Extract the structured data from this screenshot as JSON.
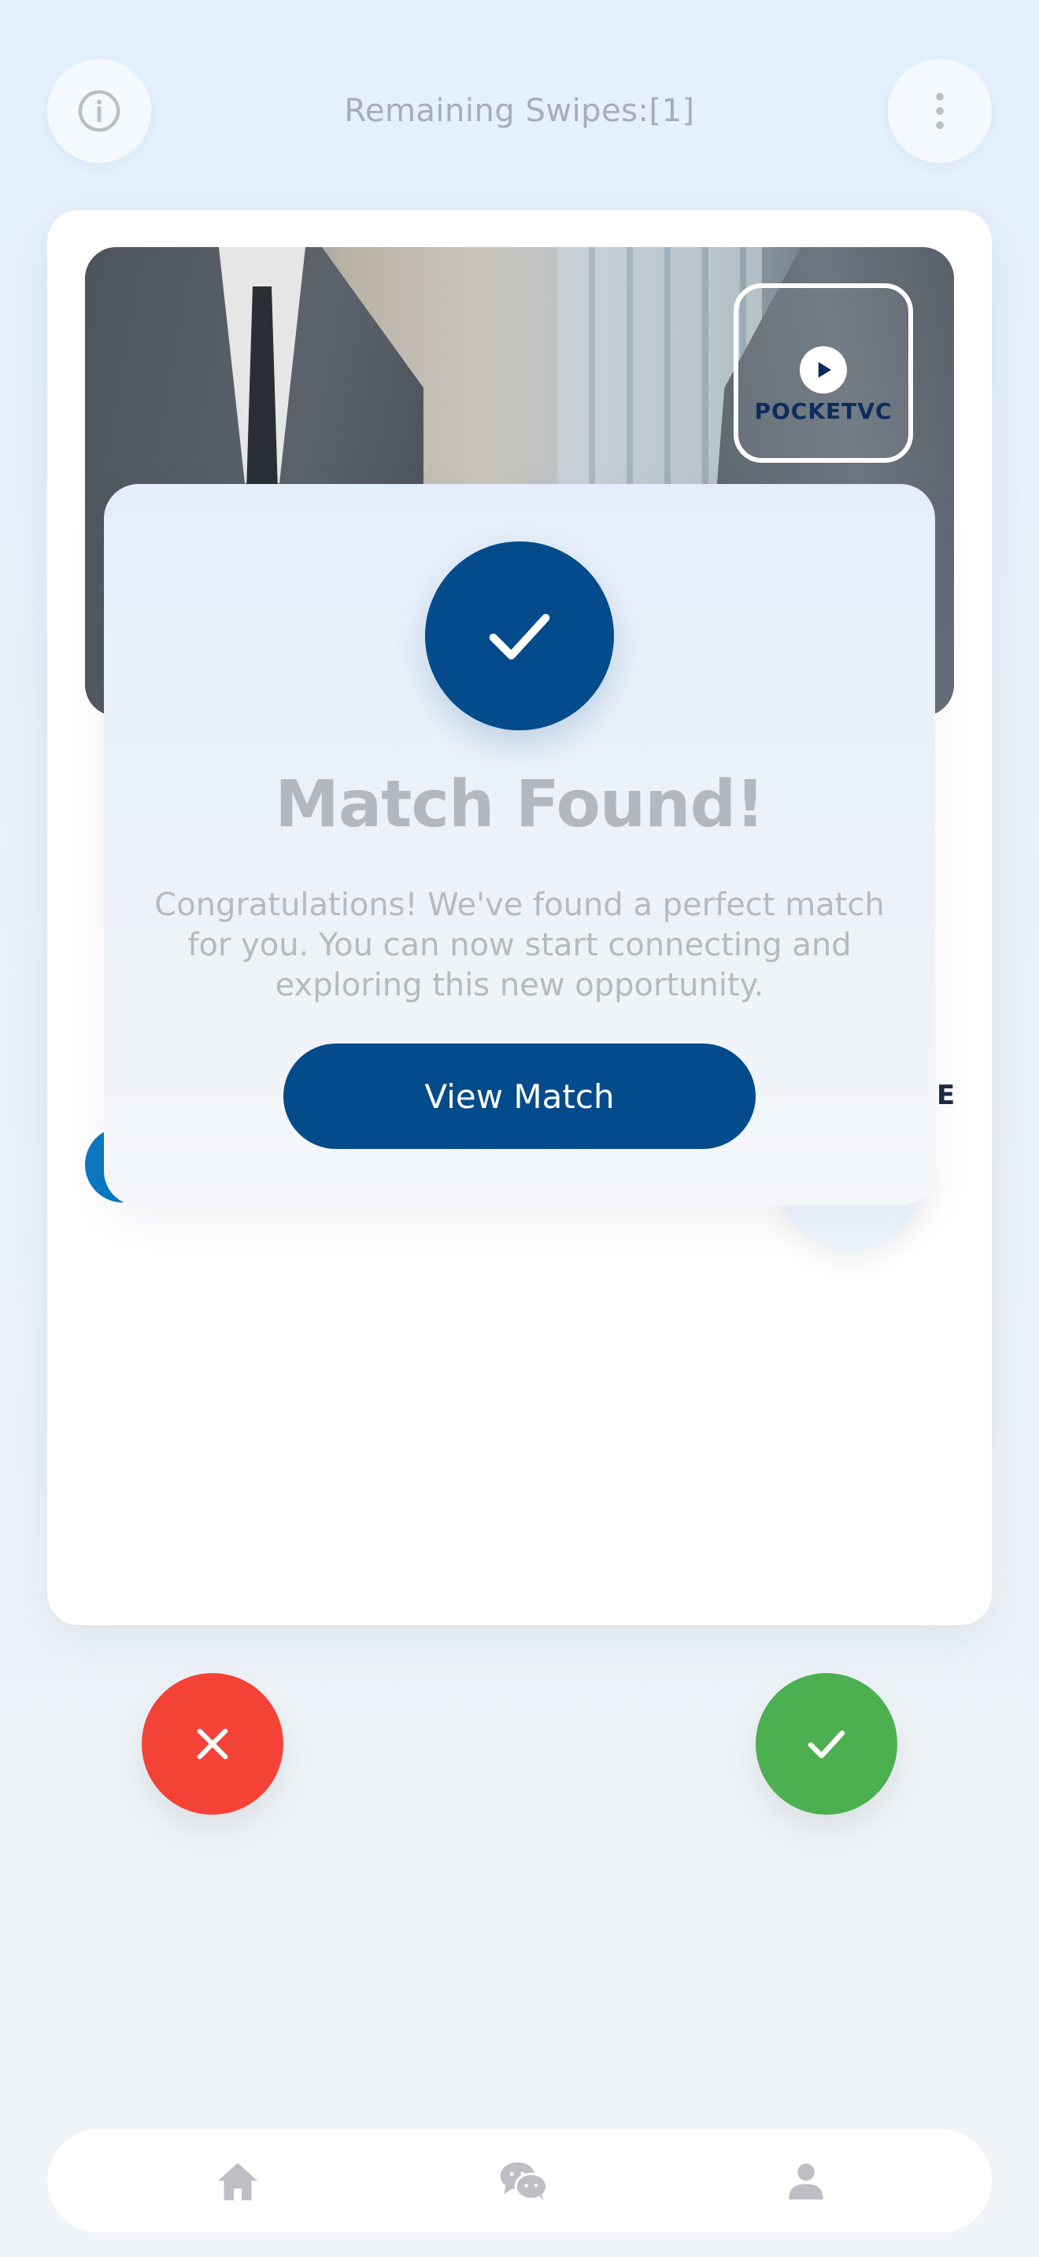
{
  "header": {
    "swipes_label": "Remaining Swipes:[1]",
    "info_icon": "info-icon",
    "menu_icon": "more-vertical-icon"
  },
  "card": {
    "video_badge": {
      "brand": "POCKETVC",
      "icon": "play-icon"
    },
    "partial_text": "E"
  },
  "modal": {
    "icon": "check-icon",
    "title": "Match Found!",
    "message": "Congratulations! We've found a perfect match for you. You can now start connecting and exploring this new opportunity.",
    "button_label": "View Match"
  },
  "actions": {
    "reject_icon": "close-icon",
    "accept_icon": "check-icon",
    "reject_color": "#f44336",
    "accept_color": "#4caf50"
  },
  "nav": {
    "items": [
      {
        "name": "home",
        "icon": "home-icon"
      },
      {
        "name": "chat",
        "icon": "chat-icon"
      },
      {
        "name": "profile",
        "icon": "profile-icon"
      }
    ]
  },
  "colors": {
    "primary": "#034b8b",
    "accent": "#0b79c3"
  }
}
